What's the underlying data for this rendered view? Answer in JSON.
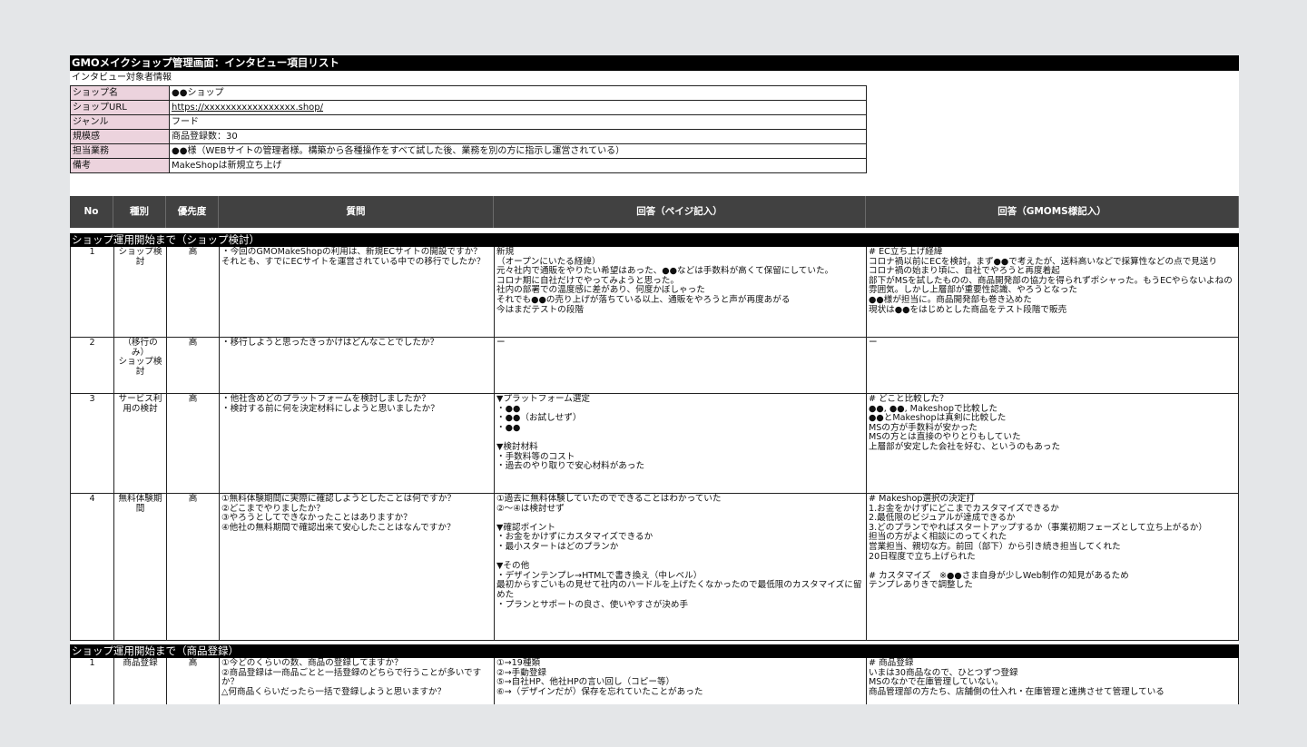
{
  "sheet_title": "GMOメイクショップ管理画面：インタビュー項目リスト",
  "subject_label": "インタビュー対象者情報",
  "info": [
    {
      "key": "ショップ名",
      "value": "●●ショップ"
    },
    {
      "key": "ショップURL",
      "value": "https://xxxxxxxxxxxxxxxxx.shop/"
    },
    {
      "key": "ジャンル",
      "value": "フード"
    },
    {
      "key": "規模感",
      "value": "商品登録数：30"
    },
    {
      "key": "担当業務",
      "value": "●●様（WEBサイトの管理者様。構築から各種操作をすべて試した後、業務を別の方に指示し運営されている）"
    },
    {
      "key": "備考",
      "value": "MakeShopは新規立ち上げ"
    }
  ],
  "columns": {
    "no": "No",
    "type": "種別",
    "priority": "優先度",
    "question": "質問",
    "answer_page": "回答（ペイジ記入）",
    "answer_gmo": "回答（GMOMS様記入）"
  },
  "sections": [
    {
      "title": "ショップ運用開始まで（ショップ検討）"
    },
    {
      "title": "ショップ運用開始まで（商品登録）"
    }
  ],
  "rows": [
    {
      "no": "1",
      "type": "ショップ検討",
      "priority": "高",
      "question": "・今回のGMOMakeShopの利用は、新規ECサイトの開設ですか？\nそれとも、すでにECサイトを運営されている中での移行でしたか？",
      "answer_page": "新規\n（オープンにいたる経緯）\n元々社内で通販をやりたい希望はあった、●●などは手数料が高くて保留にしていた。\nコロナ期に自社だけでやってみようと思った。\n社内の部署での温度感に差があり、何度かぼしゃった\nそれでも●●の売り上げが落ちている以上、通販をやろうと声が再度あがる\n今はまだテストの段階",
      "answer_gmo": "# EC立ち上げ経緯\nコロナ禍以前にECを検討。まず●●で考えたが、送料高いなどで採算性などの点で見送り\nコロナ禍の始まり頃に、自社でやろうと再度着起\n部下がMSを試したものの、商品開発部の協力を得られずポシャった。もうECやらないよねの雰囲気。しかし上層部が重要性認識、やろうとなった\n●●様が担当に。商品開発部も巻き込めた\n現状は●●をはじめとした商品をテスト段階で販売"
    },
    {
      "no": "2",
      "type": "（移行のみ）\nショップ検討",
      "priority": "高",
      "question": "・移行しようと思ったきっかけはどんなことでしたか？",
      "answer_page": "ー",
      "answer_gmo": "ー"
    },
    {
      "no": "3",
      "type": "サービス利用の検討",
      "priority": "高",
      "question": "・他社含めどのプラットフォームを検討しましたか？\n・検討する前に何を決定材料にしようと思いましたか？",
      "answer_page": "▼プラットフォーム選定\n・●●\n・●●（お試しせず）\n・●●\n\n▼検討材料\n・手数料等のコスト\n・過去のやり取りで安心材料があった",
      "answer_gmo": "# どこと比較した？\n●●, ●●, Makeshopで比較した\n●●とMakeshopは真剣に比較した\nMSの方が手数料が安かった\nMSの方とは直接のやりとりもしていた\n上層部が安定した会社を好む、というのもあった"
    },
    {
      "no": "4",
      "type": "無料体験期間",
      "priority": "高",
      "question": "①無料体験期間に実際に確認しようとしたことは何ですか？\n②どこまでやりましたか？\n③やろうとしてできなかったことはありますか？\n④他社の無料期間で確認出来て安心したことはなんですか？",
      "answer_page": "①過去に無料体験していたのでできることはわかっていた\n②～④は検討せず\n\n▼確認ポイント\n・お金をかけずにカスタマイズできるか\n・最小スタートはどのプランか\n\n▼その他\n・デザインテンプレ→HTMLで書き換え（中レベル）\n最初からすごいもの見せて社内のハードルを上げたくなかったので最低限のカスタマイズに留めた\n・プランとサポートの良さ、使いやすさが決め手",
      "answer_gmo": "# Makeshop選択の決定打\n1.お金をかけずにどこまでカスタマイズできるか\n2.最低限のビジュアルが達成できるか\n3.どのプランでやればスタートアップするか（事業初期フェーズとして立ち上がるか）\n担当の方がよく相談にのってくれた\n営業担当、親切な方。前回（部下）から引き続き担当してくれた\n20日程度で立ち上げられた\n\n# カスタマイズ　※●●さま自身が少しWeb制作の知見があるため\nテンプレありきで調整した"
    },
    {
      "no": "1",
      "type": "商品登録",
      "priority": "高",
      "question": "①今どのくらいの数、商品の登録してますか？\n②商品登録は一商品ごとと一括登録のどちらで行うことが多いですか？\n△何商品くらいだったら一括で登録しようと思いますか？",
      "answer_page": "①→19種類\n②→手動登録\n⑤→自社HP、他社HPの言い回し（コピー等）\n⑥→（デザインだが）保存を忘れていたことがあった",
      "answer_gmo": "# 商品登録\nいまは30商品なので、ひとつずつ登録\nMSのなかで在庫管理していない。\n商品管理部の方たち、店舗側の仕入れ・在庫管理と連携させて管理している"
    }
  ]
}
